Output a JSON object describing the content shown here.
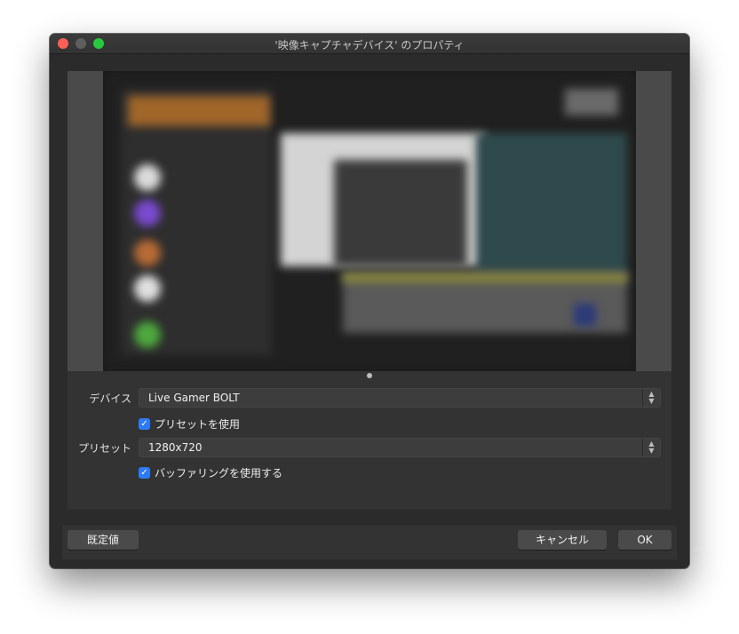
{
  "window": {
    "title": "'映像キャプチャデバイス' のプロパティ"
  },
  "form": {
    "device_label": "デバイス",
    "device_value": "Live Gamer BOLT",
    "use_preset_label": "プリセットを使用",
    "use_preset_checked": true,
    "preset_label": "プリセット",
    "preset_value": "1280x720",
    "use_buffering_label": "バッファリングを使用する",
    "use_buffering_checked": true
  },
  "buttons": {
    "defaults": "既定値",
    "cancel": "キャンセル",
    "ok": "OK"
  },
  "icons": {
    "checkmark": "✓",
    "updown": "▲▼"
  },
  "colors": {
    "accent": "#2c7bf6",
    "window_bg": "#2b2b2b",
    "close": "#fe5f57",
    "zoom": "#28c840"
  }
}
